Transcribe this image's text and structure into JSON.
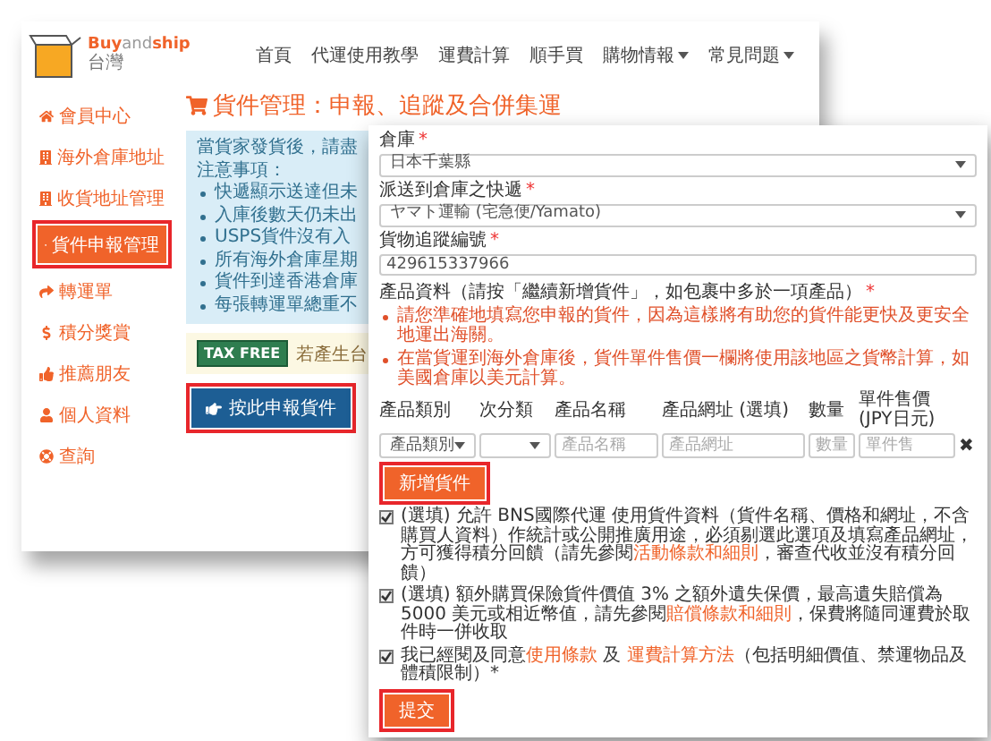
{
  "logo": {
    "parts": [
      "Buy",
      "and",
      "ship"
    ],
    "region": "台灣"
  },
  "nav": [
    {
      "label": "首頁",
      "dropdown": false
    },
    {
      "label": "代運使用教學",
      "dropdown": false
    },
    {
      "label": "運費計算",
      "dropdown": false
    },
    {
      "label": "順手買",
      "dropdown": false
    },
    {
      "label": "購物情報",
      "dropdown": true
    },
    {
      "label": "常見問題",
      "dropdown": true
    }
  ],
  "sidebar": [
    {
      "label": "會員中心",
      "selected": false
    },
    {
      "label": "海外倉庫地址",
      "selected": false
    },
    {
      "label": "收貨地址管理",
      "selected": false
    },
    {
      "label": "貨件申報管理",
      "selected": true
    },
    {
      "label": "轉運單",
      "selected": false
    },
    {
      "label": "積分獎賞",
      "selected": false
    },
    {
      "label": "推薦朋友",
      "selected": false
    },
    {
      "label": "個人資料",
      "selected": false
    },
    {
      "label": "查詢",
      "selected": false
    }
  ],
  "page_title": "貨件管理：申報、追蹤及合併集運",
  "notice": {
    "intro": [
      "當貨家發貨後，請盡",
      "注意事項："
    ],
    "bullets": [
      "快遞顯示送達但未",
      "入庫後數天仍未出",
      "USPS貨件沒有入",
      "所有海外倉庫星期",
      "貨件到達香港倉庫",
      "每張轉運單總重不"
    ]
  },
  "tax_free": {
    "badge": "TAX FREE",
    "text": "若產生台"
  },
  "declare_button": "按此申報貨件",
  "form": {
    "fields": [
      {
        "label": "倉庫",
        "required_mark": "*",
        "kind": "select",
        "value": "日本千葉縣"
      },
      {
        "label": "派送到倉庫之快遞",
        "required_mark": "*",
        "kind": "select",
        "value": "ヤマト運輸 (宅急便/Yamato)"
      },
      {
        "label": "貨物追蹤編號",
        "required_mark": "*",
        "kind": "text",
        "value": "429615337966"
      }
    ],
    "products_title": "產品資料（請按「繼續新增貨件」，如包裹中多於一項產品）",
    "products_required_mark": "*",
    "notes": [
      "請您準確地填寫您申報的貨件，因為這樣將有助您的貨件能更快及更安全地運出海關。",
      "在當貨運到海外倉庫後，貨件單件售價一欄將使用該地區之貨幣計算，如美國倉庫以美元計算。"
    ],
    "columns": [
      "產品類別",
      "次分類",
      "產品名稱",
      "產品網址 (選填)",
      "數量",
      "單件售價(JPY日元)"
    ],
    "row": [
      {
        "kind": "select",
        "value": "產品類別"
      },
      {
        "kind": "select"
      },
      {
        "kind": "input",
        "placeholder": "產品名稱"
      },
      {
        "kind": "input",
        "placeholder": "產品網址"
      },
      {
        "kind": "input",
        "placeholder": "數量"
      },
      {
        "kind": "input",
        "placeholder": "單件售"
      }
    ],
    "remove": "✖",
    "add_button": "新增貨件",
    "checks": [
      {
        "checked": true,
        "segments": [
          {
            "kind": "text",
            "text": "(選填) 允許 BNS國際代運 使用貨件資料（貨件名稱、價格和網址，不含購買人資料）作統計或公開推廣用途，必須剔選此選項及填寫產品網址，方可獲得積分回饋（請先參閱"
          },
          {
            "kind": "link",
            "text": "活動條款和細則"
          },
          {
            "kind": "text",
            "text": "，審查代收並沒有積分回饋）"
          }
        ]
      },
      {
        "checked": true,
        "segments": [
          {
            "kind": "text",
            "text": "(選填) 額外購買保險貨件價值 3% 之額外遺失保價，最高遺失賠償為5000 美元或相近幣值，請先參閱"
          },
          {
            "kind": "link",
            "text": "賠償條款和細則"
          },
          {
            "kind": "text",
            "text": "，保費將隨同運費於取件時一併收取"
          }
        ]
      },
      {
        "checked": true,
        "segments": [
          {
            "kind": "text",
            "text": "我已經閱及同意"
          },
          {
            "kind": "link",
            "text": "使用條款"
          },
          {
            "kind": "text",
            "text": " 及 "
          },
          {
            "kind": "link",
            "text": "運費計算方法"
          },
          {
            "kind": "text",
            "text": "（包括明細價值、禁運物品及體積限制）"
          },
          {
            "kind": "text",
            "text": "*"
          }
        ]
      }
    ],
    "submit": "提交"
  }
}
